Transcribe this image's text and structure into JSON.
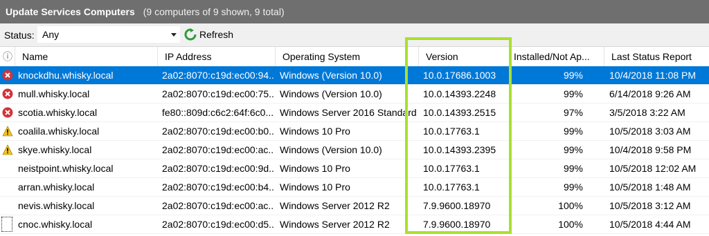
{
  "window": {
    "title": "Update Services Computers",
    "subtitle": "(9 computers of 9 shown, 9 total)"
  },
  "toolbar": {
    "status_label": "Status:",
    "status_value": "Any",
    "refresh_label": "Refresh"
  },
  "columns": {
    "info": "ⓘ",
    "name": "Name",
    "ip": "IP Address",
    "os": "Operating System",
    "version": "Version",
    "installed": "Installed/Not Ap...",
    "last": "Last Status Report"
  },
  "rows": [
    {
      "status": "error",
      "name": "knockdhu.whisky.local",
      "ip": "2a02:8070:c19d:ec00:94...",
      "os": "Windows (Version 10.0)",
      "version": "10.0.17686.1003",
      "installed": "99%",
      "last": "10/4/2018 11:08 PM"
    },
    {
      "status": "error",
      "name": "mull.whisky.local",
      "ip": "2a02:8070:c19d:ec00:75...",
      "os": "Windows (Version 10.0)",
      "version": "10.0.14393.2248",
      "installed": "99%",
      "last": "6/14/2018 9:26 AM"
    },
    {
      "status": "error",
      "name": "scotia.whisky.local",
      "ip": "fe80::809d:c6c2:64f:6c0...",
      "os": "Windows Server 2016 Standard",
      "version": "10.0.14393.2515",
      "installed": "97%",
      "last": "3/5/2018 3:22 AM"
    },
    {
      "status": "warning",
      "name": "coalila.whisky.local",
      "ip": "2a02:8070:c19d:ec00:b0...",
      "os": "Windows 10 Pro",
      "version": "10.0.17763.1",
      "installed": "99%",
      "last": "10/5/2018 3:03 AM"
    },
    {
      "status": "warning",
      "name": "skye.whisky.local",
      "ip": "2a02:8070:c19d:ec00:ac...",
      "os": "Windows (Version 10.0)",
      "version": "10.0.14393.2395",
      "installed": "99%",
      "last": "10/4/2018 9:58 PM"
    },
    {
      "status": "none",
      "name": "neistpoint.whisky.local",
      "ip": "2a02:8070:c19d:ec00:9d...",
      "os": "Windows 10 Pro",
      "version": "10.0.17763.1",
      "installed": "99%",
      "last": "10/5/2018 12:02 AM"
    },
    {
      "status": "none",
      "name": "arran.whisky.local",
      "ip": "2a02:8070:c19d:ec00:b4...",
      "os": "Windows 10 Pro",
      "version": "10.0.17763.1",
      "installed": "99%",
      "last": "10/5/2018 1:48 AM"
    },
    {
      "status": "none",
      "name": "nevis.whisky.local",
      "ip": "2a02:8070:c19d:ec00:ac...",
      "os": "Windows Server 2012 R2",
      "version": "7.9.9600.18970",
      "installed": "100%",
      "last": "10/5/2018 3:12 AM"
    },
    {
      "status": "none",
      "name": "cnoc.whisky.local",
      "ip": "2a02:8070:c19d:ec00:d5...",
      "os": "Windows Server 2012 R2",
      "version": "7.9.9600.18970",
      "installed": "100%",
      "last": "10/5/2018 4:44 AM"
    }
  ],
  "colors": {
    "titlebar": "#6f6f6f",
    "selection": "#0078d7",
    "highlight": "#a8e02e",
    "error": "#d13438",
    "warning": "#f5c518"
  }
}
